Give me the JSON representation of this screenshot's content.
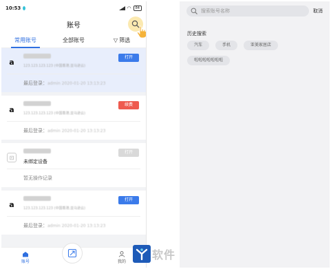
{
  "statusbar": {
    "time": "10:53",
    "battery": "84"
  },
  "header": {
    "title": "账号"
  },
  "tabs": [
    {
      "label": "常用账号",
      "active": true
    },
    {
      "label": "全部账号",
      "active": false
    },
    {
      "label": "筛选",
      "active": false
    }
  ],
  "cards": [
    {
      "logo": "a",
      "sub": "123.123.123.123 (中国香港,亚马逊云)",
      "foot_label": "最后登录：",
      "foot_value": "admin  2020-01-20  13:13:23",
      "button": "打开",
      "button_style": "blue",
      "selected": true
    },
    {
      "logo": "a",
      "sub": "123.123.123.123 (中国香港,亚马逊云)",
      "foot_label": "最后登录：",
      "foot_value": "admin  2020-01-20  13:13:23",
      "button": "续费",
      "button_style": "red",
      "selected": false
    },
    {
      "logo": "",
      "sub": "未绑定设备",
      "foot_label": "暂无操作记录",
      "foot_value": "",
      "button": "打开",
      "button_style": "grey",
      "selected": false
    },
    {
      "logo": "a",
      "sub": "123.123.123.123 (中国香港,亚马逊云)",
      "foot_label": "最后登录：",
      "foot_value": "admin  2020-01-20  13:13:23",
      "button": "打开",
      "button_style": "blue",
      "selected": false
    }
  ],
  "bottom_nav": [
    {
      "label": "账号",
      "icon": "home-icon",
      "active": true
    },
    {
      "label": "我的",
      "icon": "user-icon",
      "active": false
    }
  ],
  "search": {
    "placeholder": "搜索账号名称",
    "cancel": "取消"
  },
  "history": {
    "title": "历史搜索",
    "items": [
      "汽车",
      "手机",
      "亚美家居店",
      "啦啦啦啦啦啦啦"
    ]
  },
  "watermark": {
    "text": "软件"
  },
  "colors": {
    "accent": "#2f6fe0",
    "button_blue": "#3b7bea",
    "button_red": "#ee5a4f",
    "search_highlight": "#fbe9b0"
  }
}
